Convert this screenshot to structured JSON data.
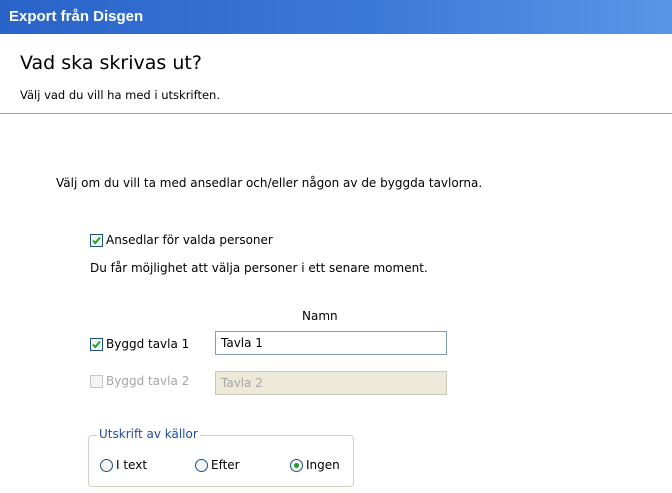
{
  "window": {
    "title": "Export från Disgen"
  },
  "header": {
    "title": "Vad ska skrivas ut?",
    "subtitle": "Välj vad du vill ha med i utskriften."
  },
  "content": {
    "intro": "Välj om du vill ta med ansedlar och/eller någon av de byggda tavlorna.",
    "ansedlar": {
      "label": "Ansedlar för valda personer",
      "checked": true,
      "hint": "Du får möjlighet att välja personer i ett senare moment."
    },
    "name_column_header": "Namn",
    "tavla1": {
      "label": "Byggd tavla 1",
      "checked": true,
      "enabled": true,
      "name_value": "Tavla 1"
    },
    "tavla2": {
      "label": "Byggd tavla 2",
      "checked": false,
      "enabled": false,
      "name_value": "Tavla 2"
    },
    "sources_group": {
      "legend": "Utskrift av källor",
      "options": [
        {
          "label": "I text",
          "selected": false
        },
        {
          "label": "Efter",
          "selected": false
        },
        {
          "label": "Ingen",
          "selected": true
        }
      ]
    }
  }
}
